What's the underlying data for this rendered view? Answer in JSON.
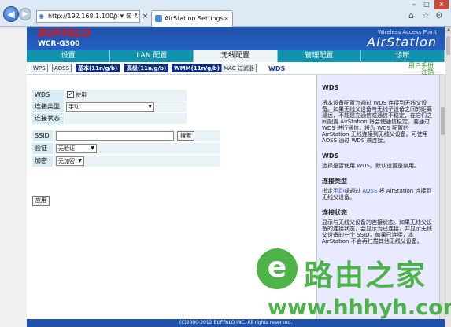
{
  "browser": {
    "address": "http://192.168.1.100/",
    "address_tools": "ρ ▾ ⊠ ↻ ×",
    "tab_title": "AirStation Settings",
    "tab_close": "×"
  },
  "header": {
    "logo": "BUFFALO",
    "model": "WCR-G300",
    "brand_sub": "Wireless Access Point",
    "brand_name": "AirStation"
  },
  "main_tabs": [
    {
      "label": "设置"
    },
    {
      "label": "LAN 配置"
    },
    {
      "label": "无线配置",
      "active": true
    },
    {
      "label": "管理配置"
    },
    {
      "label": "诊断"
    }
  ],
  "sub_nav": {
    "items": [
      {
        "label": "WPS"
      },
      {
        "label": "AOSS"
      },
      {
        "label": "基本(11n/g/b)"
      },
      {
        "label": "高级(11n/g/b)"
      },
      {
        "label": "WMM(11n/g/b)"
      },
      {
        "label": "MAC 过滤器"
      }
    ],
    "current": "WDS",
    "manual_link": "用户手册",
    "logout_link": "注销"
  },
  "form": {
    "wds_label": "WDS",
    "wds_checkbox_label": "使用",
    "conn_type_label": "连接类型",
    "conn_type_value": "手动",
    "conn_status_label": "连接状态",
    "ssid_label": "SSID",
    "ssid_value": "",
    "search_button": "搜索",
    "auth_label": "验证",
    "auth_value": "无验证",
    "encrypt_label": "加密",
    "encrypt_value": "无加密",
    "apply_button": "应用"
  },
  "help": {
    "title": "WDS",
    "intro": "将本设备配置为通过 WDS 连接到无线父设备。如果无线父设备与无线子设备之间的距离遥远，不能建立通信或通信不稳定，在它们之间配置 AirStation 将会使通信稳定。要通过 WDS 进行通信，将为 WDS 配置的 AirStation 无线连接到无线父设备。可使用 AOSS 通过 WDS 来连接。",
    "wds_title": "WDS",
    "wds_text": "选择是否使用 WDS。默认设置是禁用。",
    "conn_title": "连接类型",
    "conn_text_pre": "指定",
    "conn_link_manual": "手动",
    "conn_text_mid": "或通过 ",
    "conn_link_aoss": "AOSS",
    "conn_text_post": " 将 AirStation 连接到无线父设备。",
    "status_title": "连接状态",
    "status_text": "显示与无线父设备的连接状态。如果无线父设备的连接状态，会显示为已连接，并显示无线父设备的一个 SSID。如果已连接，本 AirStation 不会再扫描其他无线父设备。"
  },
  "footer": "(C)2000-2012 BUFFALO INC. All rights reserved.",
  "watermark": {
    "icon_letter": "e",
    "name": "路由之家",
    "url": "www.hhhyh.com"
  }
}
